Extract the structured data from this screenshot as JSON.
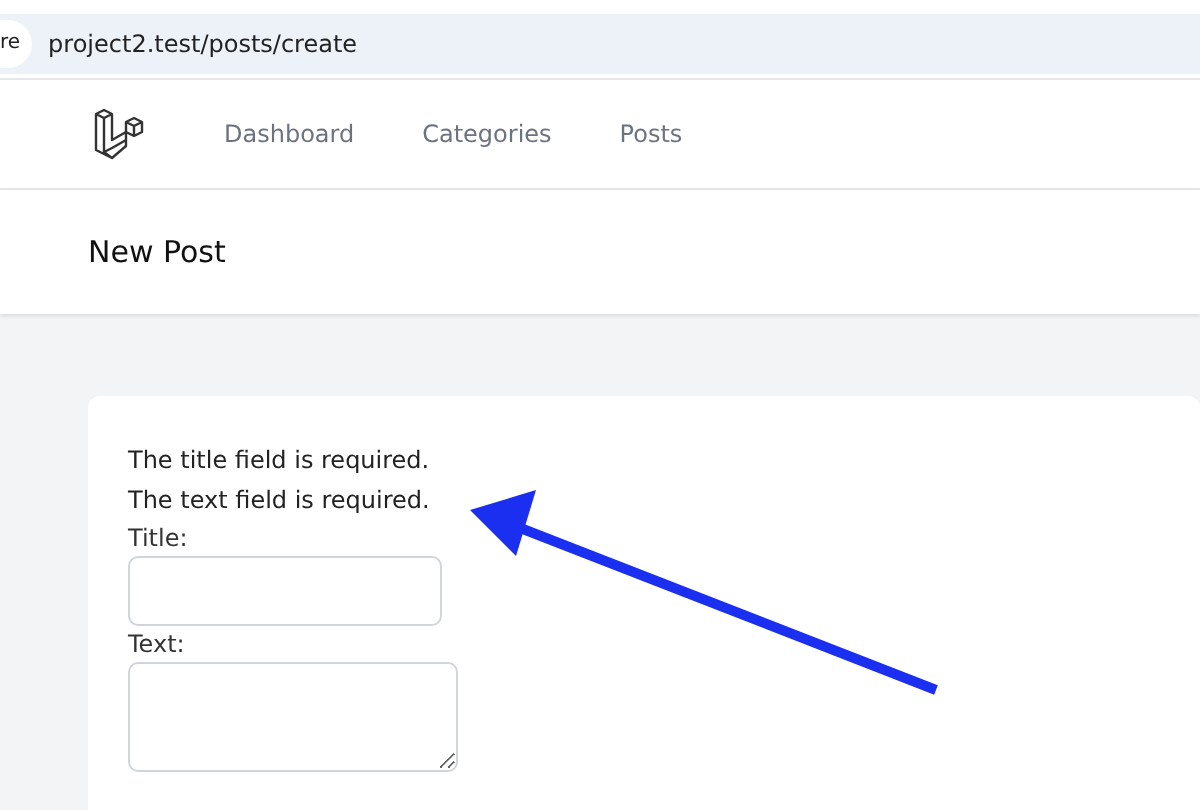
{
  "browser": {
    "badge": "re",
    "url": "project2.test/posts/create"
  },
  "nav": {
    "links": [
      {
        "label": "Dashboard"
      },
      {
        "label": "Categories"
      },
      {
        "label": "Posts"
      }
    ]
  },
  "header": {
    "title": "New Post"
  },
  "form": {
    "errors": [
      "The title field is required.",
      "The text field is required."
    ],
    "fields": [
      {
        "kind": "input",
        "label": "Title:"
      },
      {
        "kind": "textarea",
        "label": "Text:"
      }
    ]
  }
}
